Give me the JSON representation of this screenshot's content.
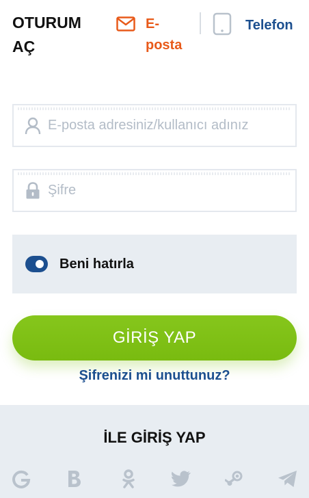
{
  "header": {
    "title": "OTURUM AÇ",
    "tab_email": "E-posta",
    "tab_phone": "Telefon"
  },
  "form": {
    "email_placeholder": "E-posta adresiniz/kullanıcı adınız",
    "password_placeholder": "Şifre",
    "remember_label": "Beni hatırla",
    "remember_on": true,
    "submit_label": "GİRİŞ YAP",
    "forgot_label": "Şifrenizi mi unuttunuz?"
  },
  "social": {
    "heading": "İLE GİRİŞ YAP",
    "icons": [
      "google-icon",
      "vk-icon",
      "odnoklassniki-icon",
      "twitter-icon",
      "steam-icon",
      "telegram-icon"
    ]
  },
  "colors": {
    "accent_orange": "#e85a1a",
    "primary_blue": "#1c4f8f",
    "button_green": "#80c016",
    "panel_gray": "#e8edf2",
    "icon_gray": "#b9c2cc"
  }
}
